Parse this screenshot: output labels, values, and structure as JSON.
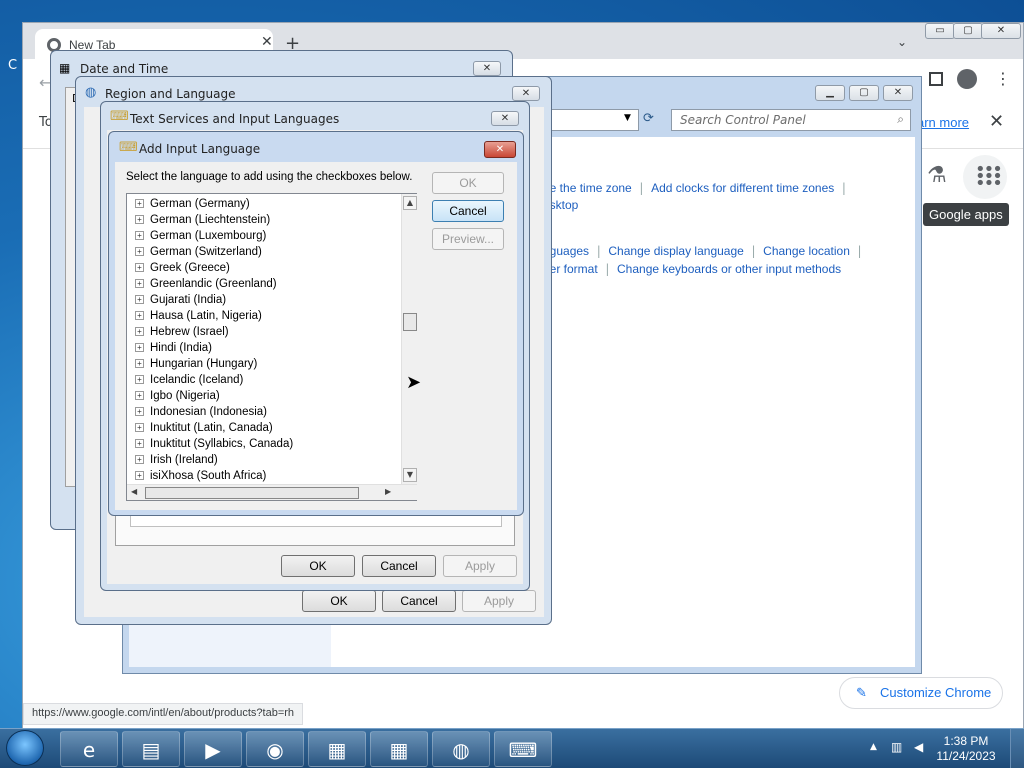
{
  "chrome": {
    "tab_title": "New Tab",
    "tab_close": "✕",
    "new_tab": "+",
    "tab_menu": "⌄",
    "minimize": "▭",
    "maximize": "▢",
    "close": "✕",
    "learn_more": "arn more",
    "bar_close": "✕",
    "apps_tooltip": "Google apps",
    "status_url": "https://www.google.com/intl/en/about/products?tab=rh",
    "customize": "Customize Chrome",
    "edge_left_1": "C",
    "edge_left_2": "To"
  },
  "control_panel": {
    "search_placeholder": "Search Control Panel",
    "links_row1": [
      "ge the time zone",
      "Add clocks for different time zones"
    ],
    "links_row1b": "esktop",
    "links_row2": [
      "nguages",
      "Change display language",
      "Change location"
    ],
    "links_row3": [
      "ber format",
      "Change keyboards or other input methods"
    ]
  },
  "date_time": {
    "title": "Date and Time",
    "edge_letter": "D"
  },
  "region": {
    "title": "Region and Language",
    "ok": "OK",
    "cancel": "Cancel",
    "apply": "Apply"
  },
  "text_services": {
    "title": "Text Services and Input Languages",
    "ok": "OK",
    "cancel": "Cancel",
    "apply": "Apply"
  },
  "add_input_language": {
    "title": "Add Input Language",
    "instruction": "Select the language to add using the checkboxes below.",
    "ok": "OK",
    "cancel": "Cancel",
    "preview": "Preview...",
    "languages": [
      "German (Germany)",
      "German (Liechtenstein)",
      "German (Luxembourg)",
      "German (Switzerland)",
      "Greek (Greece)",
      "Greenlandic (Greenland)",
      "Gujarati (India)",
      "Hausa (Latin, Nigeria)",
      "Hebrew (Israel)",
      "Hindi (India)",
      "Hungarian (Hungary)",
      "Icelandic (Iceland)",
      "Igbo (Nigeria)",
      "Indonesian (Indonesia)",
      "Inuktitut (Latin, Canada)",
      "Inuktitut (Syllabics, Canada)",
      "Irish (Ireland)",
      "isiXhosa (South Africa)"
    ]
  },
  "taskbar": {
    "time": "1:38 PM",
    "date": "11/24/2023",
    "items": [
      "internet-explorer",
      "file-explorer",
      "media-player",
      "chrome",
      "control-panel",
      "date-time",
      "region-language",
      "text-services"
    ]
  }
}
